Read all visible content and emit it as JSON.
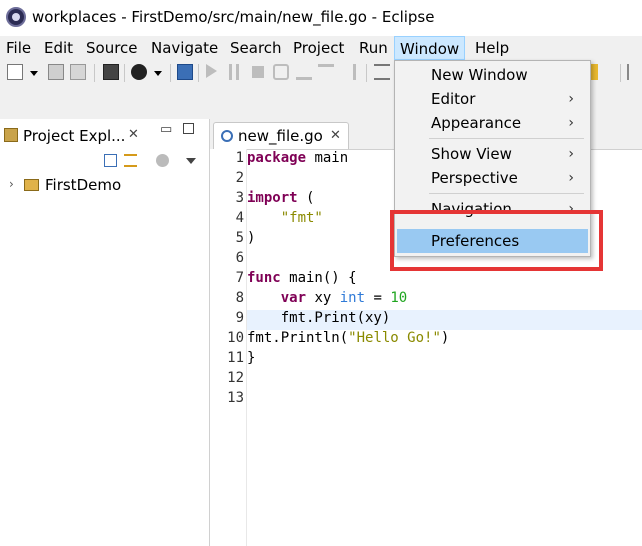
{
  "window": {
    "title": "workplaces - FirstDemo/src/main/new_file.go - Eclipse"
  },
  "menubar": {
    "items": [
      "File",
      "Edit",
      "Source",
      "Navigate",
      "Search",
      "Project",
      "Run",
      "Window",
      "Help"
    ]
  },
  "window_menu": {
    "items": [
      {
        "label": "New Window",
        "submenu": false
      },
      {
        "label": "Editor",
        "submenu": true
      },
      {
        "label": "Appearance",
        "submenu": true
      },
      {
        "label": "Show View",
        "submenu": true
      },
      {
        "label": "Perspective",
        "submenu": true
      },
      {
        "label": "Navigation",
        "submenu": true
      },
      {
        "label": "Preferences",
        "submenu": false,
        "selected": true
      }
    ],
    "arrow": "›"
  },
  "project_explorer": {
    "tab_label": "Project Expl...",
    "close_glyph": "✕",
    "tree": [
      {
        "label": "FirstDemo",
        "expanded": false
      }
    ]
  },
  "editor": {
    "tab_label": "new_file.go",
    "close_glyph": "✕",
    "line_numbers": [
      "1",
      "2",
      "3",
      "4",
      "5",
      "6",
      "7",
      "8",
      "9",
      "10",
      "11",
      "12",
      "13"
    ],
    "lines": [
      {
        "num": "1",
        "tokens": [
          {
            "t": "package",
            "c": "kw"
          },
          {
            "t": " main",
            "c": ""
          }
        ]
      },
      {
        "num": "2",
        "tokens": []
      },
      {
        "num": "3",
        "tokens": [
          {
            "t": "import",
            "c": "kw"
          },
          {
            "t": " (",
            "c": ""
          }
        ]
      },
      {
        "num": "4",
        "tokens": [
          {
            "t": "    ",
            "c": ""
          },
          {
            "t": "\"fmt\"",
            "c": "str"
          }
        ]
      },
      {
        "num": "5",
        "tokens": [
          {
            "t": ")",
            "c": ""
          }
        ]
      },
      {
        "num": "6",
        "tokens": []
      },
      {
        "num": "7",
        "tokens": [
          {
            "t": "func",
            "c": "kw"
          },
          {
            "t": " main() {",
            "c": ""
          }
        ]
      },
      {
        "num": "8",
        "tokens": [
          {
            "t": "    ",
            "c": ""
          },
          {
            "t": "var",
            "c": "kw"
          },
          {
            "t": " xy ",
            "c": ""
          },
          {
            "t": "int",
            "c": "typ"
          },
          {
            "t": " = ",
            "c": ""
          },
          {
            "t": "10",
            "c": "num"
          }
        ]
      },
      {
        "num": "9",
        "tokens": [
          {
            "t": "    fmt.Print(xy)",
            "c": ""
          }
        ]
      },
      {
        "num": "10",
        "tokens": [
          {
            "t": "fmt.Println(",
            "c": ""
          },
          {
            "t": "\"Hello Go!\"",
            "c": "str"
          },
          {
            "t": ")",
            "c": ""
          }
        ]
      },
      {
        "num": "11",
        "tokens": [
          {
            "t": "}",
            "c": ""
          }
        ]
      },
      {
        "num": "12",
        "tokens": []
      },
      {
        "num": "13",
        "tokens": []
      }
    ],
    "current_line": "9"
  },
  "colors": {
    "keyword": "#7f0055",
    "string": "#8a8a00",
    "type": "#2f7ad7",
    "number": "#1fa51f",
    "menu_selected": "#99c9f2",
    "highlight_box": "#e53535"
  },
  "icons": [
    "eclipse-app-icon",
    "new-icon",
    "save-icon",
    "save-all-icon",
    "terminal-icon",
    "debug-person-icon",
    "monitor-icon",
    "resume-icon",
    "suspend-icon",
    "terminate-icon",
    "disconnect-icon",
    "step-into-icon",
    "step-over-icon",
    "step-return-icon",
    "folder-icon",
    "collapse-all-icon",
    "link-editor-icon",
    "view-menu-icon"
  ]
}
